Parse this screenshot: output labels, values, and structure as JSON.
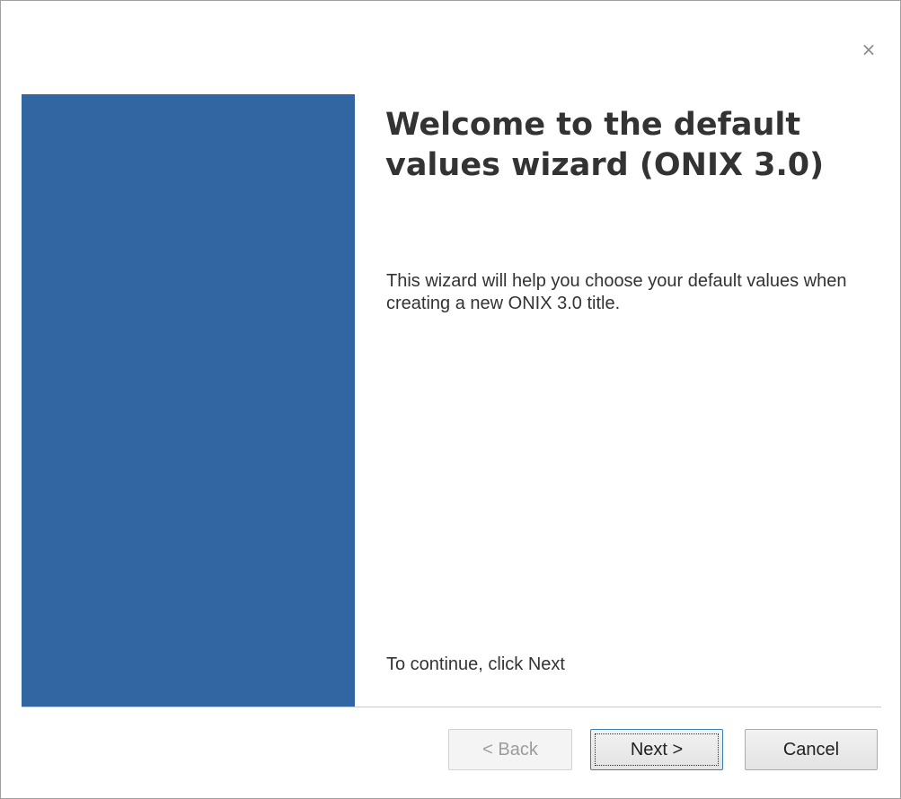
{
  "dialog": {
    "close_glyph": "×",
    "title": "Welcome to the default values wizard (ONIX 3.0)",
    "description": "This wizard will help you choose your default values when creating a new ONIX 3.0 title.",
    "continue_hint": "To continue, click Next",
    "side_panel_color": "#3266a3"
  },
  "buttons": {
    "back_label": "< Back",
    "next_label": "Next >",
    "cancel_label": "Cancel",
    "back_enabled": false
  }
}
